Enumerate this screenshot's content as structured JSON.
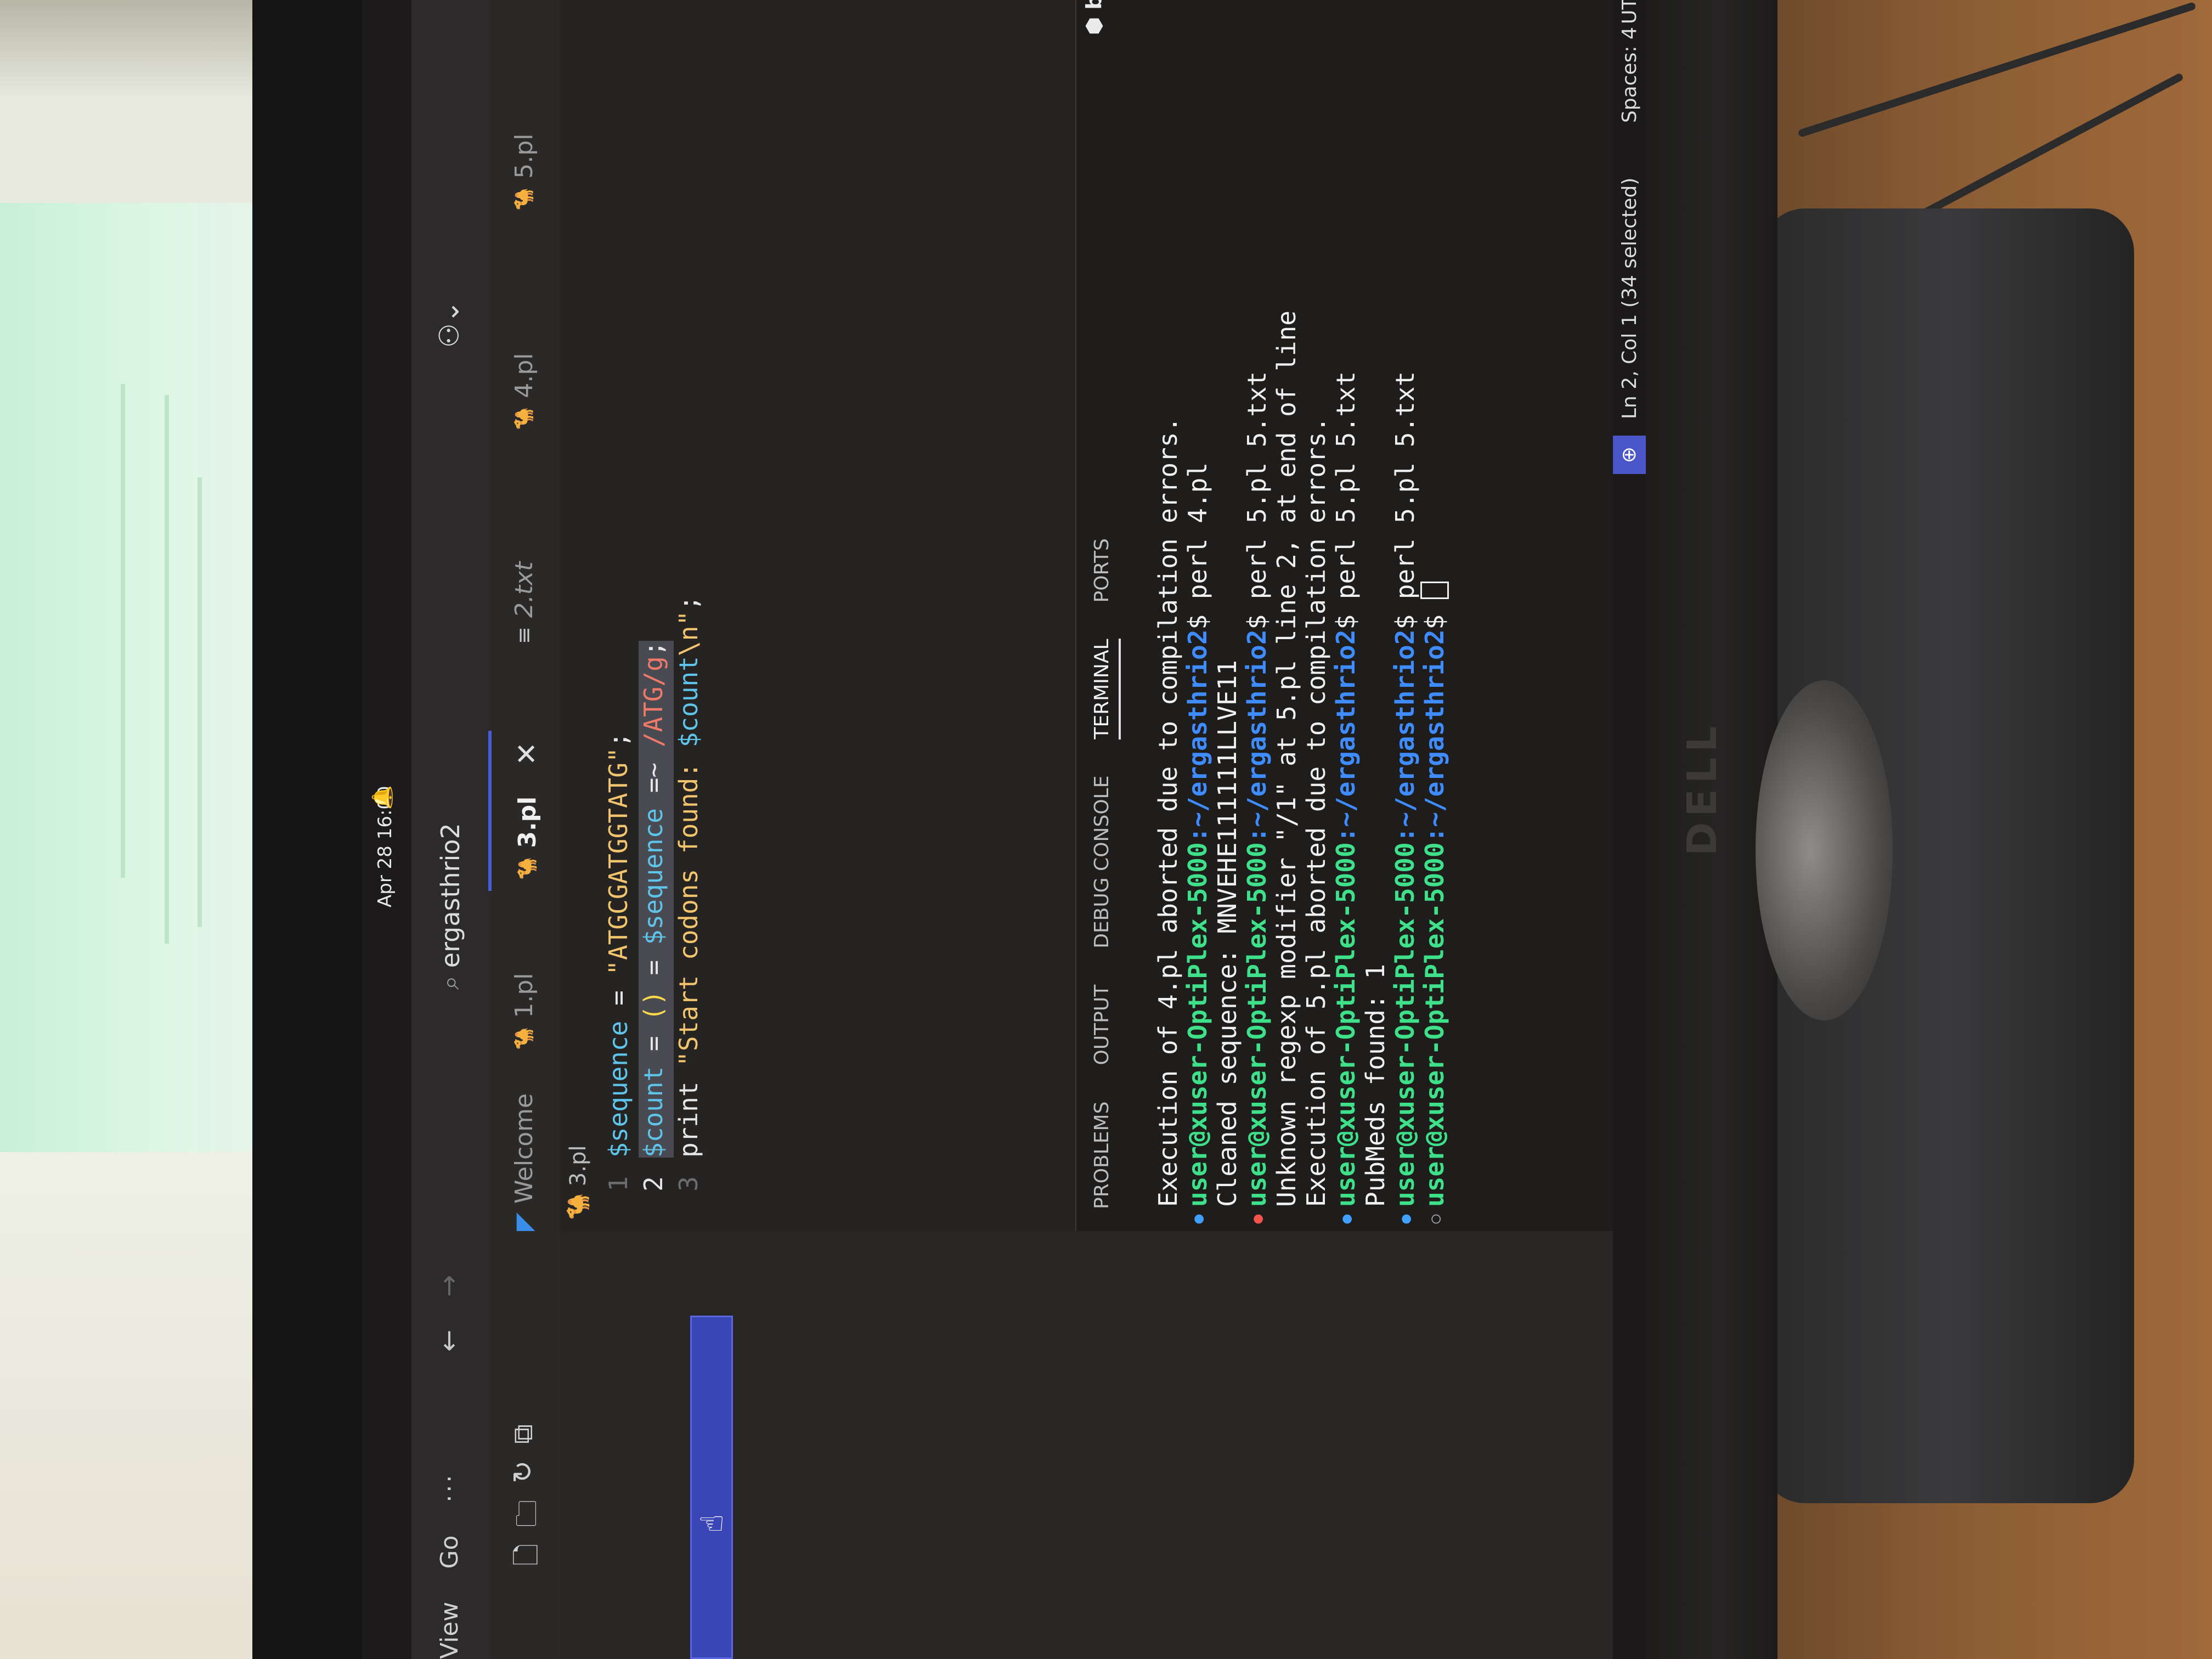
{
  "gnome": {
    "clock": "Apr 28 16:00",
    "bell_icon": "bell-icon"
  },
  "menu": {
    "items": [
      "View",
      "Go"
    ],
    "more": "···"
  },
  "command_center": {
    "label": "ergasthrio2"
  },
  "tabs": [
    {
      "label": "Welcome",
      "icon": "vscode-icon",
      "active": false
    },
    {
      "label": "1.pl",
      "icon": "perl-icon",
      "active": false
    },
    {
      "label": "3.pl",
      "icon": "perl-icon",
      "active": true
    },
    {
      "label": "2.txt",
      "icon": "text-file-icon",
      "active": false
    },
    {
      "label": "4.pl",
      "icon": "perl-icon",
      "active": false
    },
    {
      "label": "5.pl",
      "icon": "perl-icon",
      "active": false
    }
  ],
  "breadcrumb": {
    "file": "3.pl"
  },
  "editor": {
    "lines": [
      {
        "n": "1",
        "text": "$sequence = \"ATGCGATGGTATG\";"
      },
      {
        "n": "2",
        "text": "$count = () = $sequence =~ /ATG/g;"
      },
      {
        "n": "3",
        "text": "print \"Start codons found: $count\\n\";"
      }
    ]
  },
  "panel": {
    "tabs": [
      "PROBLEMS",
      "OUTPUT",
      "DEBUG CONSOLE",
      "TERMINAL",
      "PORTS"
    ],
    "active_tab": "TERMINAL",
    "shell": "bash"
  },
  "terminal": {
    "prompt_user": "user@xuser-OptiPlex-5000",
    "prompt_path": ":~/ergasthrio2",
    "lines": [
      {
        "dot": "",
        "text": "Execution of 4.pl aborted due to compilation errors.",
        "prompt": false
      },
      {
        "dot": "blue",
        "text": "$ perl 4.pl",
        "prompt": true
      },
      {
        "dot": "",
        "text": "Cleaned sequence: MNVEHE111111LLVE11",
        "prompt": false
      },
      {
        "dot": "red",
        "text": "$ perl 5.pl 5.txt",
        "prompt": true
      },
      {
        "dot": "",
        "text": "Unknown regexp modifier \"/1\" at 5.pl line 2, at end of line",
        "prompt": false
      },
      {
        "dot": "",
        "text": "Execution of 5.pl aborted due to compilation errors.",
        "prompt": false
      },
      {
        "dot": "blue",
        "text": "$ perl 5.pl 5.txt",
        "prompt": true
      },
      {
        "dot": "",
        "text": "PubMeds found: 1",
        "prompt": false
      },
      {
        "dot": "blue",
        "text": "$ perl 5.pl 5.txt",
        "prompt": true
      },
      {
        "dot": "hollow",
        "text": "$ ",
        "prompt": true
      }
    ]
  },
  "statusbar": {
    "position": "Ln 2, Col 1 (34 selected)",
    "spaces": "Spaces: 4",
    "encoding": "UTF-"
  },
  "monitor_brand": "DELL"
}
